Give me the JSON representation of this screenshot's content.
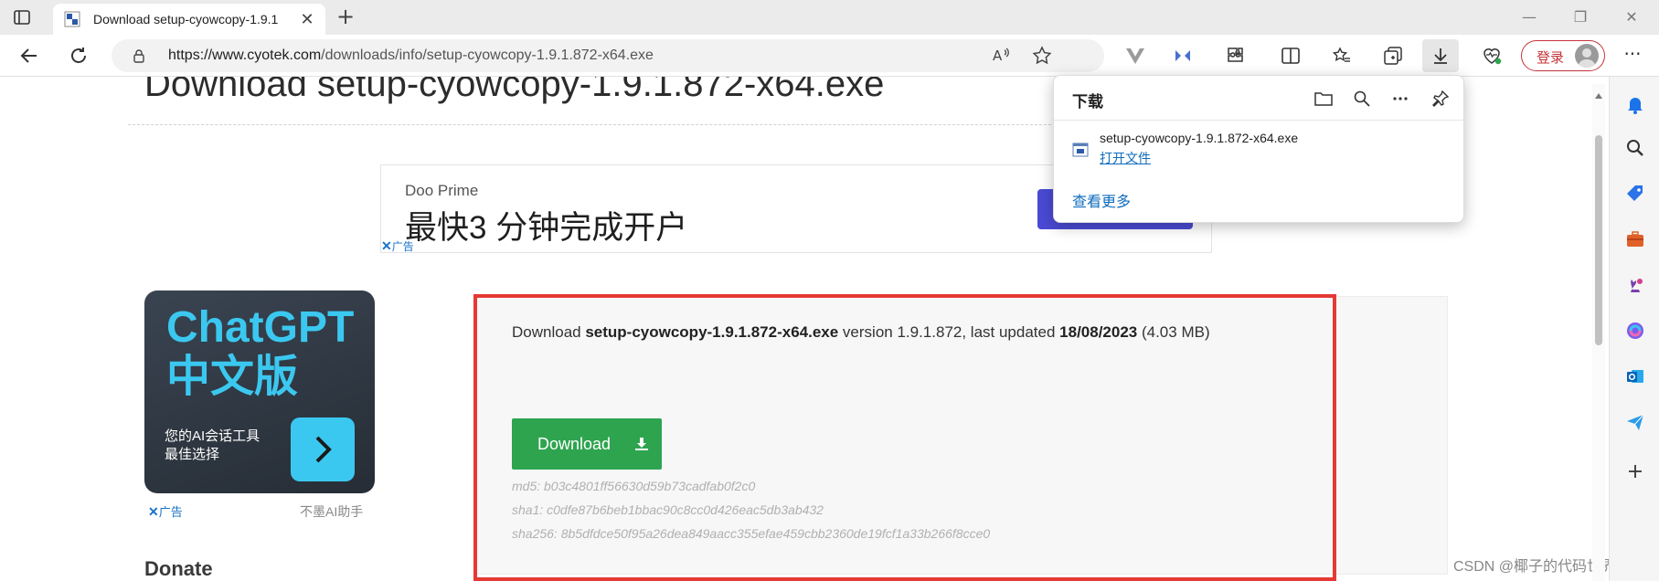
{
  "browser": {
    "tab": {
      "title": "Download setup-cyowcopy-1.9.1",
      "close_glyph": "✕"
    },
    "new_tab_glyph": "+",
    "window_controls": {
      "minimize": "—",
      "restore": "❐",
      "close": "✕"
    },
    "address": {
      "host": "https://www.cyotek.com",
      "path": "/downloads/info/setup-cyowcopy-1.9.1.872-x64.exe"
    },
    "login_label": "登录",
    "more_glyph": "···"
  },
  "page": {
    "title": "Download setup-cyowcopy-1.9.1.872-x64.exe",
    "ad_banner": {
      "brand": "Doo Prime",
      "headline": "最快3 分钟完成开户",
      "tag_x": "✕",
      "tag_label": "广告"
    },
    "side_ad": {
      "title_line1": "ChatGPT",
      "title_line2": "中文版",
      "sub_line1": "您的AI会话工具",
      "sub_line2": "最佳选择",
      "tag_x": "✕",
      "tag_label": "广告",
      "brand": "不墨AI助手"
    },
    "donate_heading": "Donate",
    "download": {
      "prefix": "Download ",
      "filename": "setup-cyowcopy-1.9.1.872-x64.exe",
      "middle": " version 1.9.1.872, last updated ",
      "date": "18/08/2023",
      "size": " (4.03 MB)",
      "button_label": "Download",
      "md5": "md5: b03c4801ff56630d59b73cadfab0f2c0",
      "sha1": "sha1: c0dfe87b6beb1bbac90c8cc0d426eac5db3ab432",
      "sha256": "sha256: 8b5dfdce50f95a26dea849aacc355efae459cbb2360de19fcf1a33b266f8cce0"
    },
    "watermark": "CSDN @椰子的代码世界"
  },
  "downloads_flyout": {
    "title": "下载",
    "file_name": "setup-cyowcopy-1.9.1.872-x64.exe",
    "open_file": "打开文件",
    "see_more": "查看更多"
  },
  "colors": {
    "accent_red": "#e53935",
    "download_green": "#2ea44f",
    "link_blue": "#0f6cbd",
    "chatgpt_cyan": "#3bc8f0"
  }
}
